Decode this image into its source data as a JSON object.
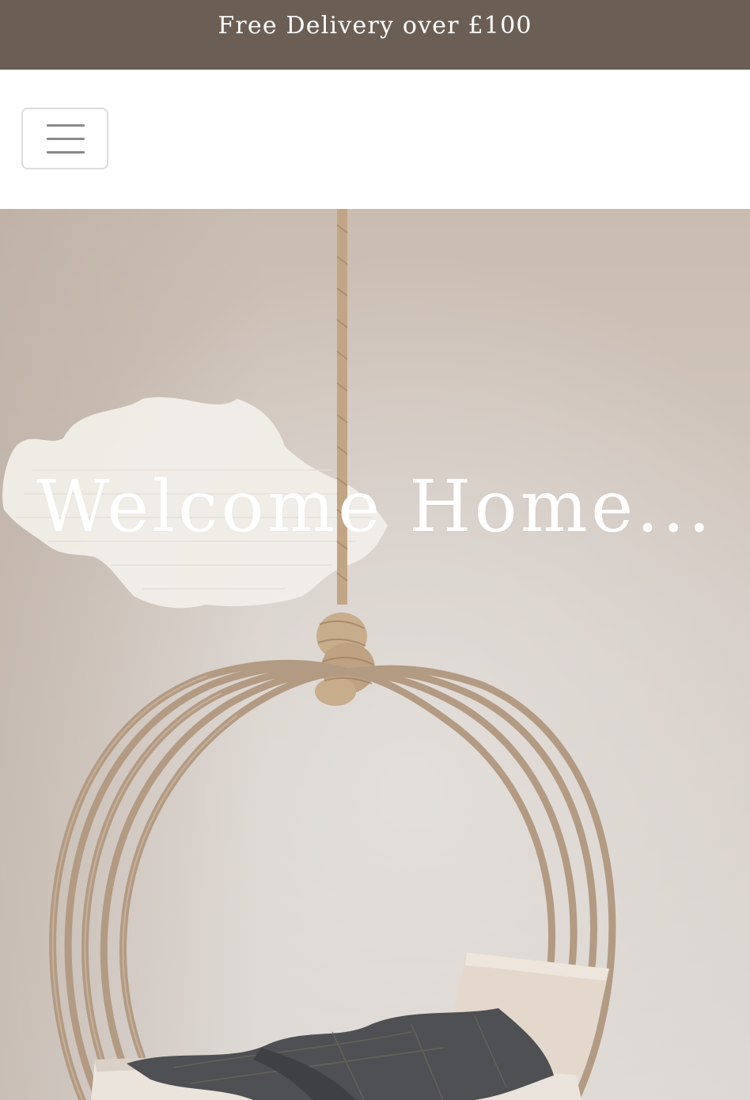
{
  "promo": {
    "text": "Free Delivery over £100"
  },
  "header": {
    "menu_icon": "hamburger-icon"
  },
  "hero": {
    "title": "Welcome Home...",
    "image": "hanging-swing-chair-photo"
  },
  "colors": {
    "promo_bg": "#6b5f55",
    "promo_text": "#ffffff",
    "hero_title": "#ffffff",
    "hero_wall": "#d8d0ca",
    "swing_frame": "#b39a82"
  }
}
